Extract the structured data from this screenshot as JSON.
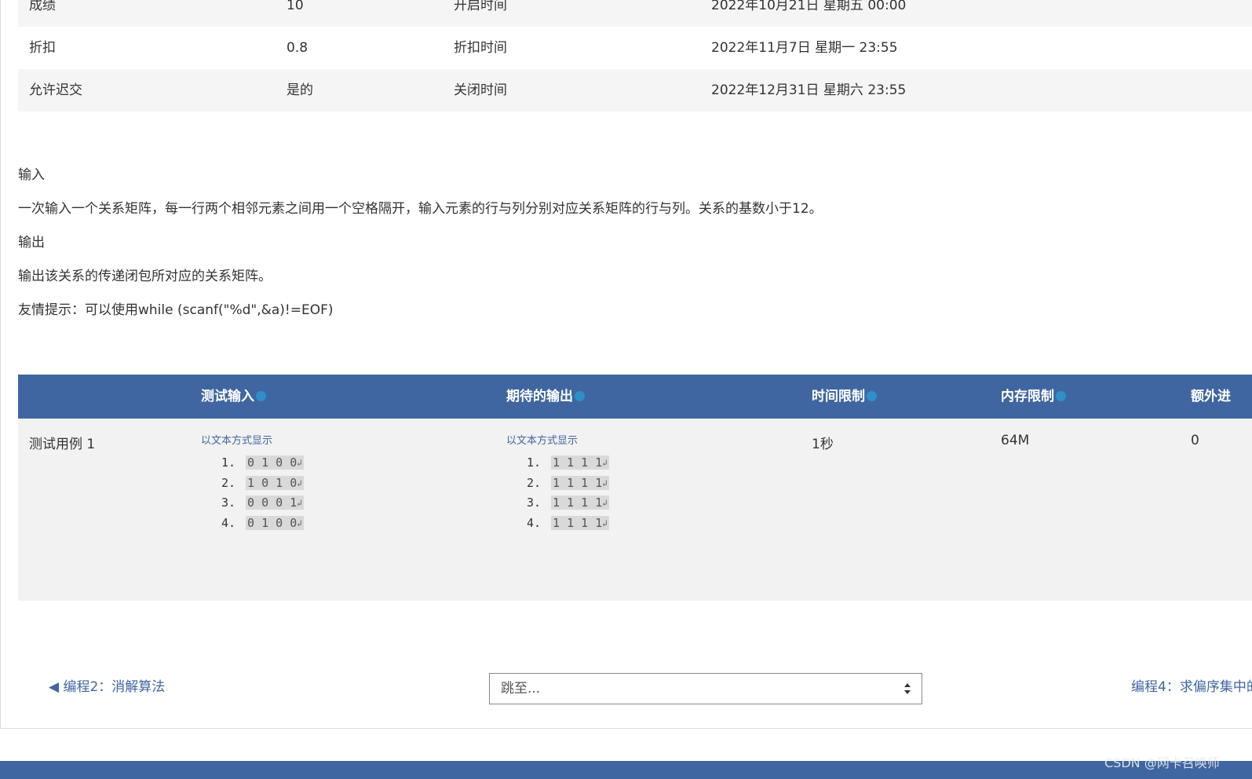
{
  "info_rows": [
    {
      "label1": "成绩",
      "value1": "10",
      "label2": "开启时间",
      "value2": "2022年10月21日 星期五 00:00"
    },
    {
      "label1": "折扣",
      "value1": "0.8",
      "label2": "折扣时间",
      "value2": "2022年11月7日 星期一 23:55"
    },
    {
      "label1": "允许迟交",
      "value1": "是的",
      "label2": "关闭时间",
      "value2": "2022年12月31日 星期六 23:55"
    }
  ],
  "description": {
    "input_heading": "输入",
    "input_text": "一次输入一个关系矩阵，每一行两个相邻元素之间用一个空格隔开，输入元素的行与列分别对应关系矩阵的行与列。关系的基数小于12。",
    "output_heading": "输出",
    "output_text": "输出该关系的传递闭包所对应的关系矩阵。",
    "hint": "友情提示：可以使用while (scanf(\"%d\",&a)!=EOF)"
  },
  "test_table": {
    "headers": {
      "test_input": "测试输入",
      "expected_output": "期待的输出",
      "time_limit": "时间限制",
      "memory_limit": "内存限制",
      "extra": "额外进"
    },
    "rows": [
      {
        "name": "测试用例 1",
        "show_text_label": "以文本方式显示",
        "input_lines": [
          {
            "num": "1.",
            "text": "0 1 0 0"
          },
          {
            "num": "2.",
            "text": "1 0 1 0"
          },
          {
            "num": "3.",
            "text": "0 0 0 1"
          },
          {
            "num": "4.",
            "text": "0 1 0 0"
          }
        ],
        "output_lines": [
          {
            "num": "1.",
            "text": "1 1 1 1"
          },
          {
            "num": "2.",
            "text": "1 1 1 1"
          },
          {
            "num": "3.",
            "text": "1 1 1 1"
          },
          {
            "num": "4.",
            "text": "1 1 1 1"
          }
        ],
        "time_limit": "1秒",
        "memory_limit": "64M",
        "extra": "0"
      }
    ]
  },
  "navigation": {
    "prev_arrow": "◀",
    "prev_label": "编程2：消解算法",
    "jump_placeholder": "跳至...",
    "next_label": "编程4：求偏序集中的"
  },
  "watermark": "CSDN @网卡召唤师",
  "colors": {
    "accent": "#3f66a0",
    "help_icon": "#2f8fc9"
  }
}
